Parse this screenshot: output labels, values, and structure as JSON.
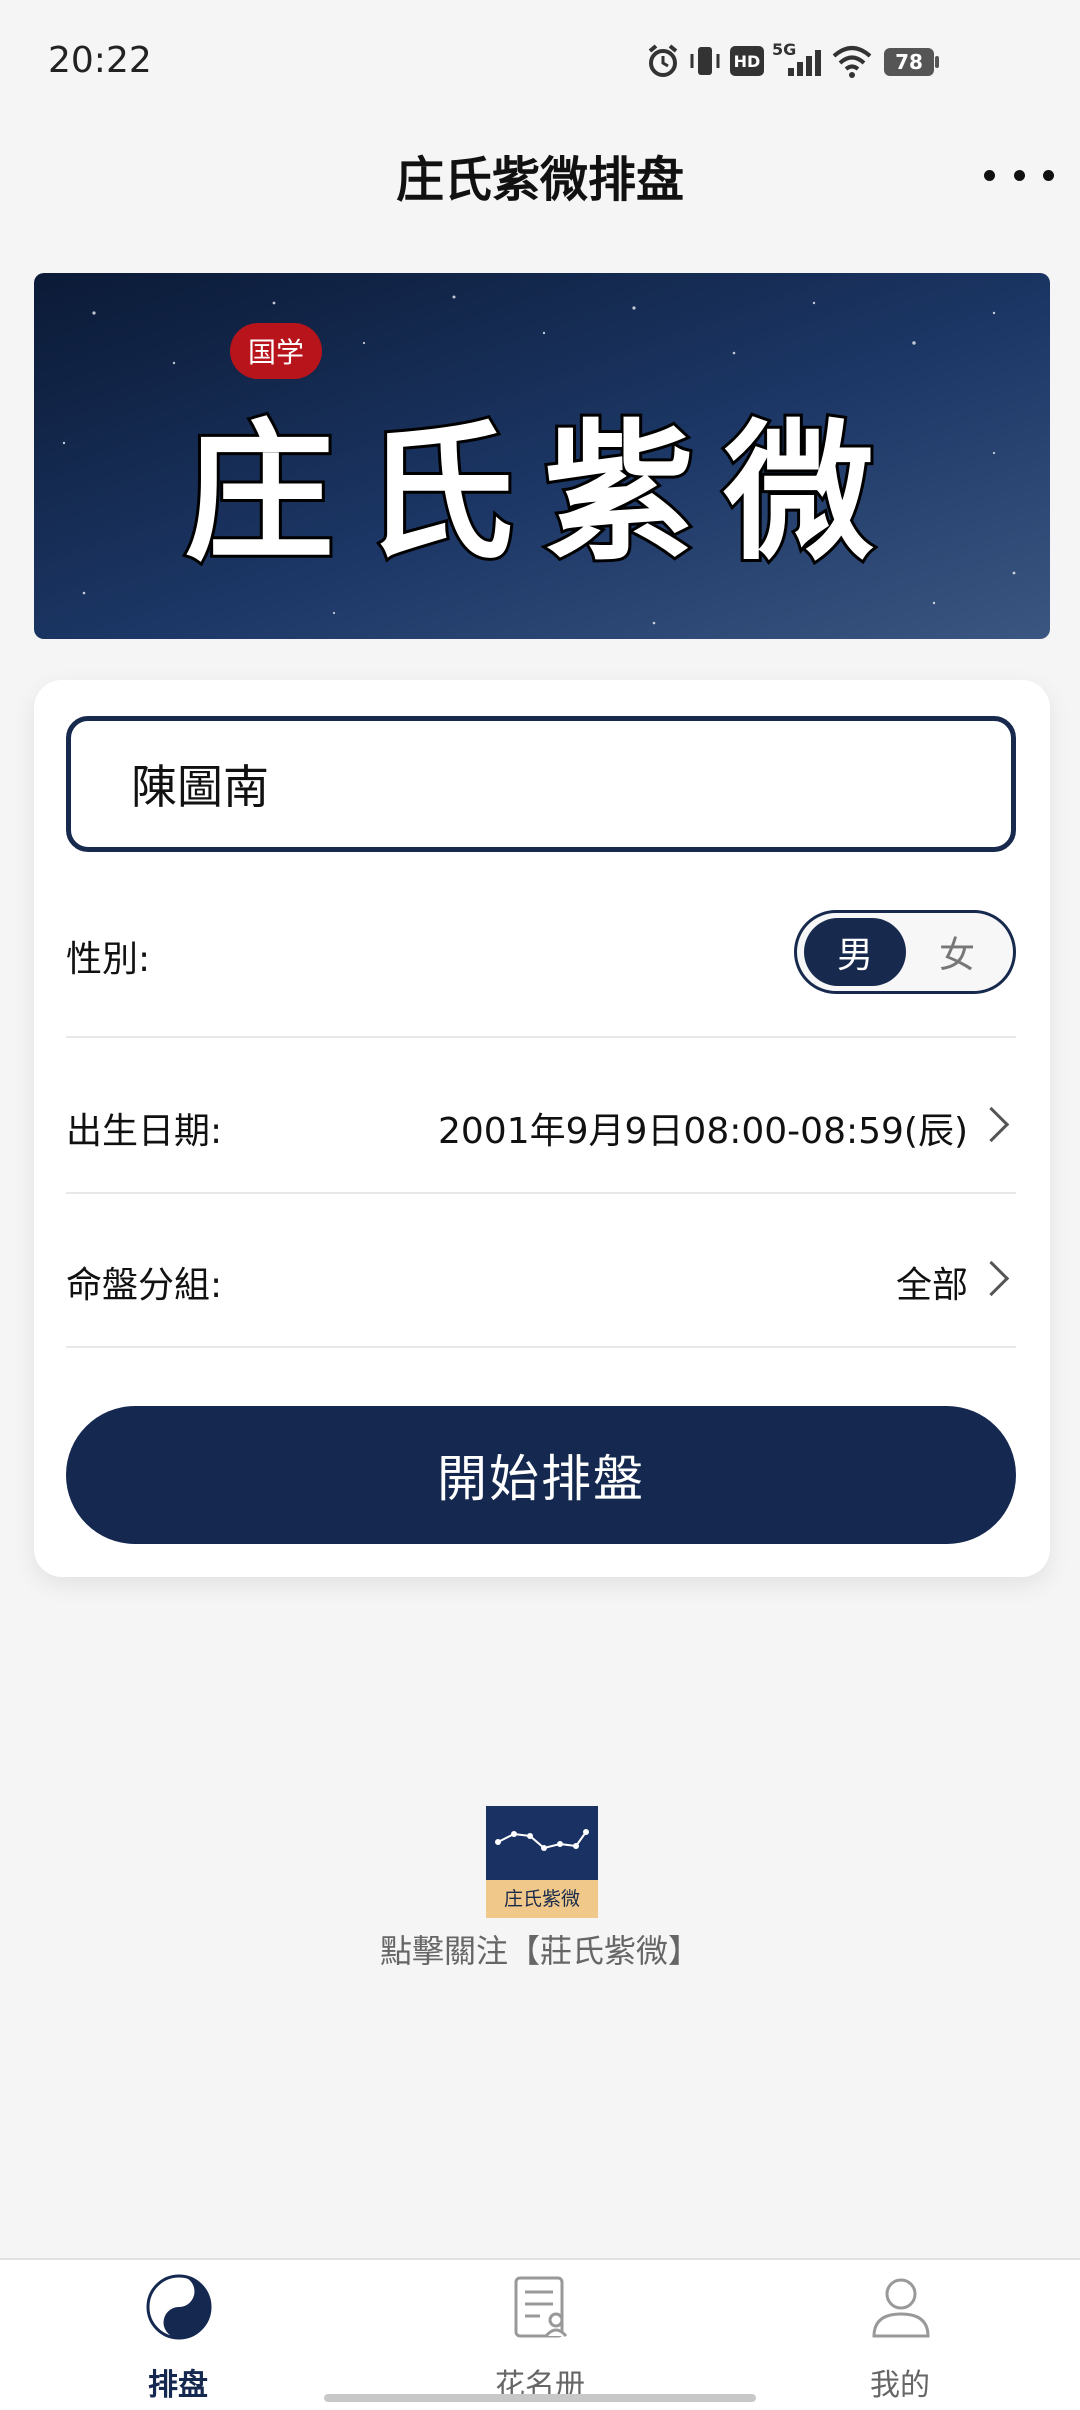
{
  "status_bar": {
    "time": "20:22",
    "icons": [
      "alarm-icon",
      "vibrate-icon",
      "hd-icon",
      "5g-signal-icon",
      "wifi-icon",
      "battery-icon"
    ],
    "network": "5G",
    "hd_badge": "HD",
    "battery": "78"
  },
  "header": {
    "title": "庄氏紫微排盘",
    "more_icon": "more-dots-icon"
  },
  "banner": {
    "badge": "国学",
    "title": "庄氏紫微"
  },
  "form": {
    "name_value": "陳圖南",
    "gender_label": "性別:",
    "gender_options": [
      "男",
      "女"
    ],
    "gender_selected": "男",
    "birth_label": "出生日期:",
    "birth_value": "2001年9月9日08:00-08:59(辰)",
    "group_label": "命盤分組:",
    "group_value": "全部",
    "start_button": "開始排盤"
  },
  "follow": {
    "logo_text": "庄氏紫微",
    "text": "點擊關注【莊氏紫微】"
  },
  "bottom_nav": {
    "items": [
      {
        "label": "排盘",
        "icon": "yin-yang-icon",
        "active": true
      },
      {
        "label": "花名册",
        "icon": "contact-list-icon",
        "active": false
      },
      {
        "label": "我的",
        "icon": "user-profile-icon",
        "active": false
      }
    ]
  },
  "colors": {
    "primary": "#15284f",
    "background": "#f5f5f6",
    "badge_red": "#b8141c"
  }
}
